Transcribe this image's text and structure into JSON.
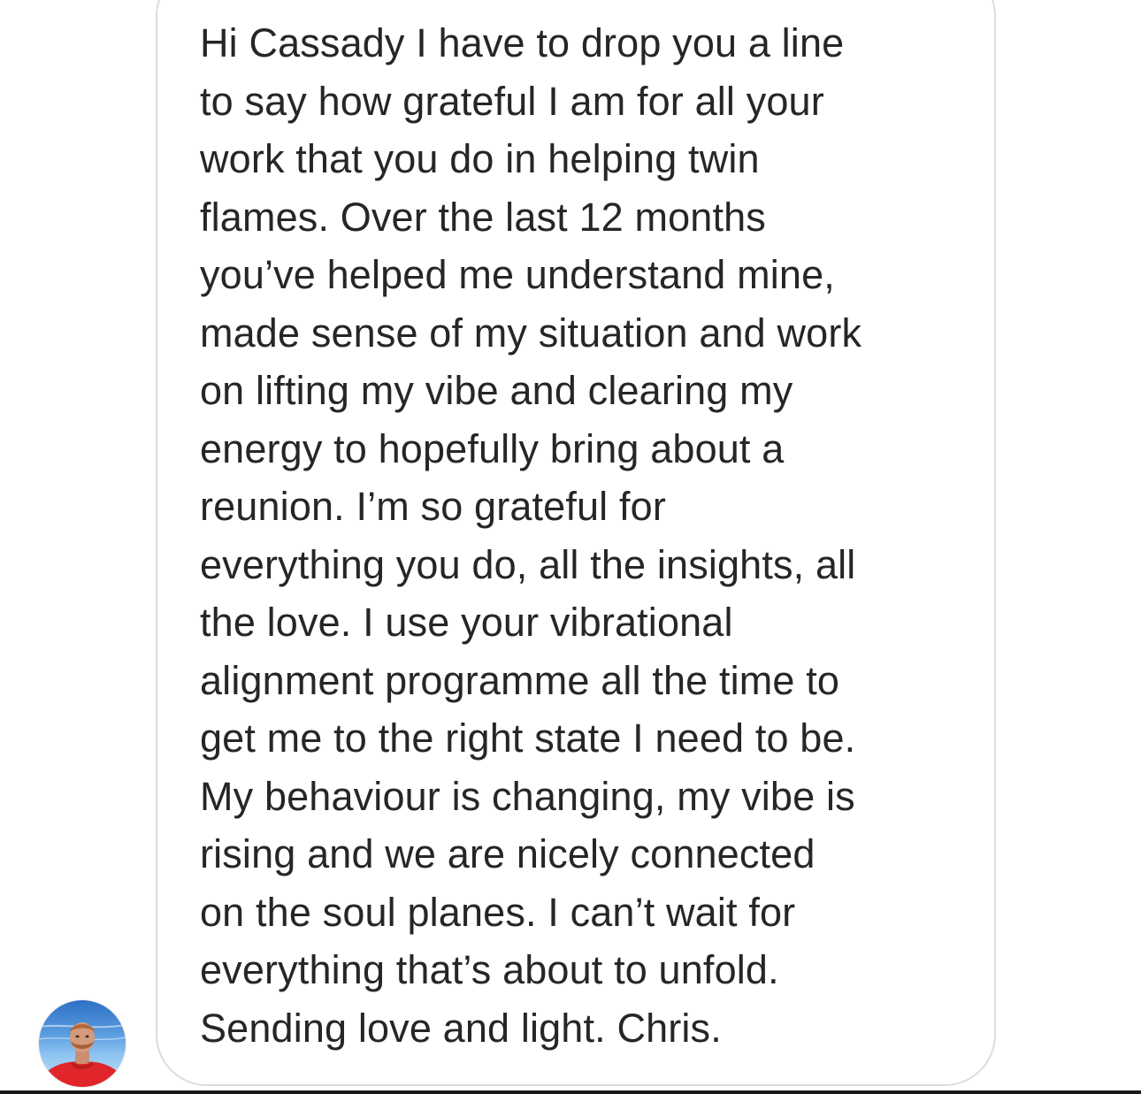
{
  "conversation": {
    "message": {
      "lines": [
        "Hi Cassady I have to drop you a line",
        "to say how grateful I am for all your",
        "work that you do in helping twin",
        "flames. Over the last 12 months",
        "you’ve helped me understand mine,",
        "made sense of my situation and work",
        "on lifting my vibe and clearing my",
        "energy to hopefully bring about a",
        "reunion. I’m so grateful for",
        "everything you do, all the insights, all",
        "the love. I use your vibrational",
        "alignment programme all the time to",
        "get me to the right state I need to be.",
        "My behaviour is changing, my vibe is",
        "rising and we are nicely connected",
        "on the soul planes. I can’t wait for",
        "everything that’s about to unfold.",
        "Sending love and light. Chris."
      ]
    },
    "sender_avatar": {
      "icon": "avatar-photo-icon"
    }
  },
  "colors": {
    "text": "#262626",
    "bubble_border": "#dcdcdc",
    "background": "#ffffff"
  }
}
